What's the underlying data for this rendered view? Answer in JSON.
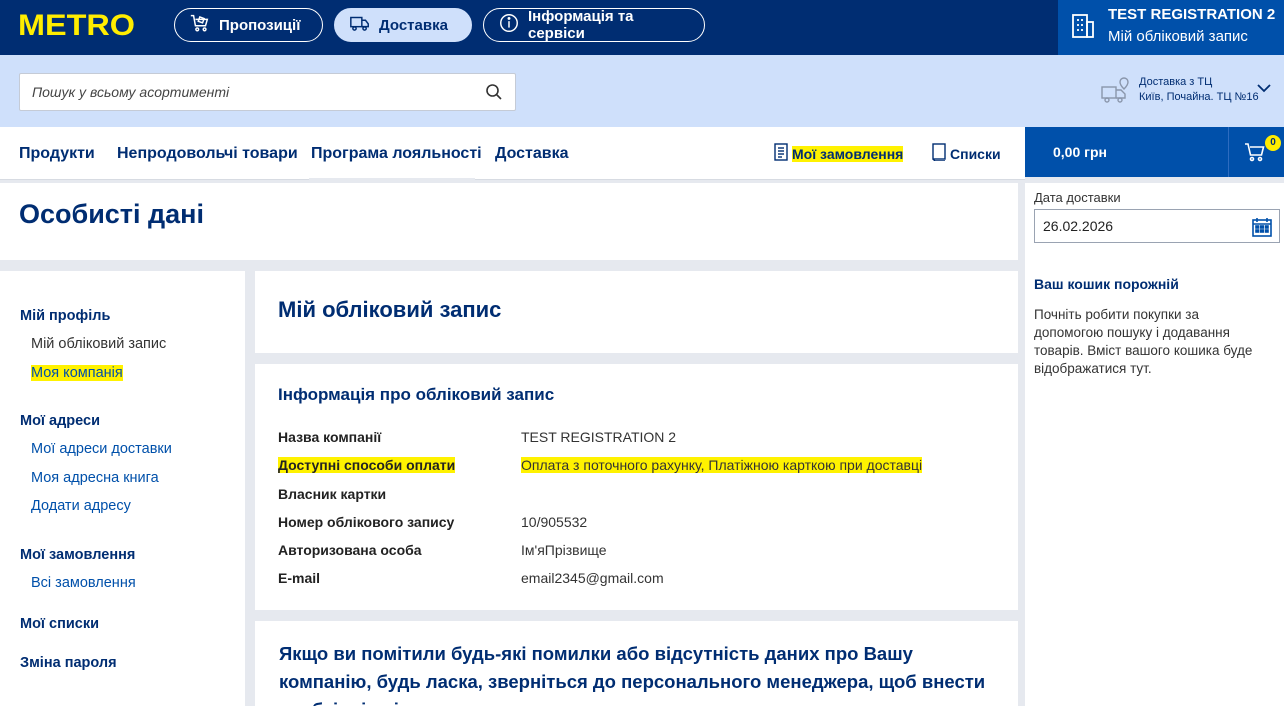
{
  "header": {
    "logo": "METRO",
    "pills": [
      {
        "label": "Пропозиції",
        "icon": "cart-tag-icon",
        "active": false
      },
      {
        "label": "Доставка",
        "icon": "truck-icon",
        "active": true
      },
      {
        "label": "Інформація та сервіси",
        "icon": "info-icon",
        "active": false
      }
    ],
    "account": {
      "name": "TEST REGISTRATION 2",
      "subtitle": "Мій обліковий запис",
      "icon": "building-icon"
    }
  },
  "search": {
    "placeholder": "Пошук у всьому асортименті",
    "icon": "search-icon"
  },
  "delivery_store": {
    "line1": "Доставка з ТЦ",
    "line2": "Київ, Почайна. ТЦ №16",
    "icon": "delivery-truck-location-icon"
  },
  "nav": {
    "items": [
      "Продукти",
      "Непродовольчі товари",
      "Програма лояльності",
      "Доставка"
    ],
    "my_orders": "Мої замовлення",
    "lists": "Списки"
  },
  "cart": {
    "total": "0,00 грн",
    "count": "0",
    "icon": "cart-icon"
  },
  "page_title": "Особисті дані",
  "sidebar": {
    "profile_head": "Мій профіль",
    "profile_items": [
      "Мій обліковий запис",
      "Моя компанія"
    ],
    "addresses_head": "Мої адреси",
    "addresses_items": [
      "Мої адреси доставки",
      "Моя адресна книга",
      "Додати адресу"
    ],
    "orders_head": "Мої замовлення",
    "orders_items": [
      "Всі замовлення"
    ],
    "lists_head": "Мої списки",
    "password_head": "Зміна пароля"
  },
  "main": {
    "card_title": "Мій обліковий запис",
    "info_title": "Інформація про обліковий запис",
    "fields": [
      {
        "label": "Назва компанії",
        "value": "TEST REGISTRATION 2"
      },
      {
        "label": "Доступні способи оплати",
        "value": "Оплата з поточного рахунку, Платіжною карткою при доставці"
      },
      {
        "label": "Власник картки",
        "value": ""
      },
      {
        "label": "Номер облікового запису",
        "value": "10/905532"
      },
      {
        "label": "Авторизована особа",
        "value": "Ім'яПрізвище"
      },
      {
        "label": "E-mail",
        "value": "email2345@gmail.com"
      }
    ],
    "note": "Якщо ви помітили будь-які помилки або відсутність даних про Вашу компанію, будь ласка, зверніться до персонального менеджера, щоб внести необхідні зміни."
  },
  "delivery_panel": {
    "date_label": "Дата доставки",
    "date_value": "26.02.2026",
    "empty_title": "Ваш кошик порожній",
    "empty_text": "Почніть робити покупки за допомогою пошуку і додавання товарів. Вміст вашого кошика буде відображатися тут."
  },
  "colors": {
    "navy": "#002d72",
    "blue": "#0050aa",
    "yellow": "#ffed00",
    "light_blue": "#cfe0fb",
    "highlight": "#fff200"
  }
}
